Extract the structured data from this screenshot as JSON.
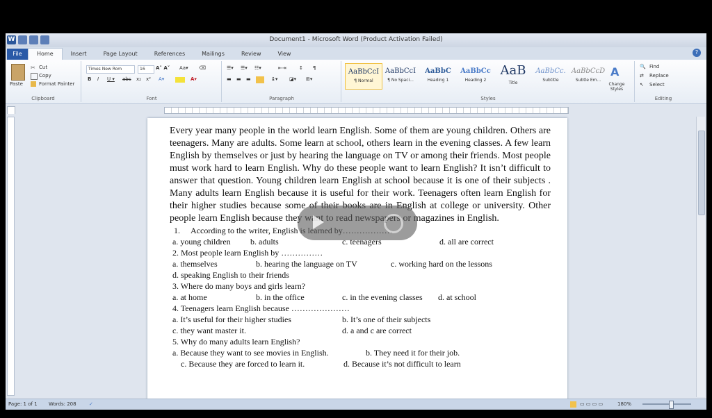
{
  "window": {
    "title": "Document1 - Microsoft Word (Product Activation Failed)"
  },
  "tabs": [
    "File",
    "Home",
    "Insert",
    "Page Layout",
    "References",
    "Mailings",
    "Review",
    "View"
  ],
  "clipboard": {
    "paste": "Paste",
    "cut": "Cut",
    "copy": "Copy",
    "format_painter": "Format Painter",
    "label": "Clipboard"
  },
  "font": {
    "name": "Times New Rom",
    "size": "16",
    "label": "Font"
  },
  "paragraph": {
    "label": "Paragraph"
  },
  "styles": {
    "label": "Styles",
    "items": [
      {
        "sample": "AaBbCcI",
        "name": "¶ Normal"
      },
      {
        "sample": "AaBbCcI",
        "name": "¶ No Spaci..."
      },
      {
        "sample": "AaBbC",
        "name": "Heading 1"
      },
      {
        "sample": "AaBbCc",
        "name": "Heading 2"
      },
      {
        "sample": "AaB",
        "name": "Title"
      },
      {
        "sample": "AaBbCc.",
        "name": "Subtitle"
      },
      {
        "sample": "AaBbCcD",
        "name": "Subtle Em..."
      }
    ],
    "change_styles": "Change Styles"
  },
  "editing": {
    "find": "Find",
    "replace": "Replace",
    "select": "Select",
    "label": "Editing"
  },
  "document": {
    "paragraph": "Every year many people in the world learn English. Some of them are young children. Others are teenagers. Many are adults. Some learn at school, others learn in the evening classes. A few learn English by themselves or just by hearing the language on TV or among their friends. Most people must work hard to learn English. Why do these people want to learn English? It isn’t difficult to answer that question. Young children learn English at school because it is one of their subjects . Many adults learn English because it is useful for their work. Teenagers often learn English for their higher studies because some of their books are in English at college or university. Other people learn English because they want to read newspapers or magazines in English.",
    "questions": {
      "q1": "1.     According to the writer, English is learned by………………",
      "q1_a": "a. young children",
      "q1_b": "b. adults",
      "q1_c": "c. teenagers",
      "q1_d": "d. all are correct",
      "q2": "2. Most people learn English by ……………",
      "q2_a": "a. themselves",
      "q2_b": "b. hearing the language on TV",
      "q2_c": "c. working hard on the lessons",
      "q2_d": "d. speaking English to their friends",
      "q3": "3. Where do many boys and girls learn?",
      "q3_a": "a. at home",
      "q3_b": "b. in the office",
      "q3_c": "c. in the evening classes",
      "q3_d": "d. at school",
      "q4": "4. Teenagers learn English because …………………",
      "q4_a": "a. It’s useful for their higher studies",
      "q4_b": "b. It’s one of their subjects",
      "q4_c": "c. they want master it.",
      "q4_d": "d. a and c are correct",
      "q5": "5. Why do many adults learn English?",
      "q5_a": "a. Because they want to see movies in English.",
      "q5_b": "b. They need it for their job.",
      "q5_c": "c. Because they are forced to learn it.",
      "q5_d": "d. Because it’s not difficult to learn"
    }
  },
  "status": {
    "page": "Page: 1 of 1",
    "words": "Words: 208",
    "zoom": "180%"
  },
  "colors": {
    "file_tab": "#2a5aa7",
    "ribbon": "#fdfdfe",
    "workspace": "#dfe5ee"
  }
}
